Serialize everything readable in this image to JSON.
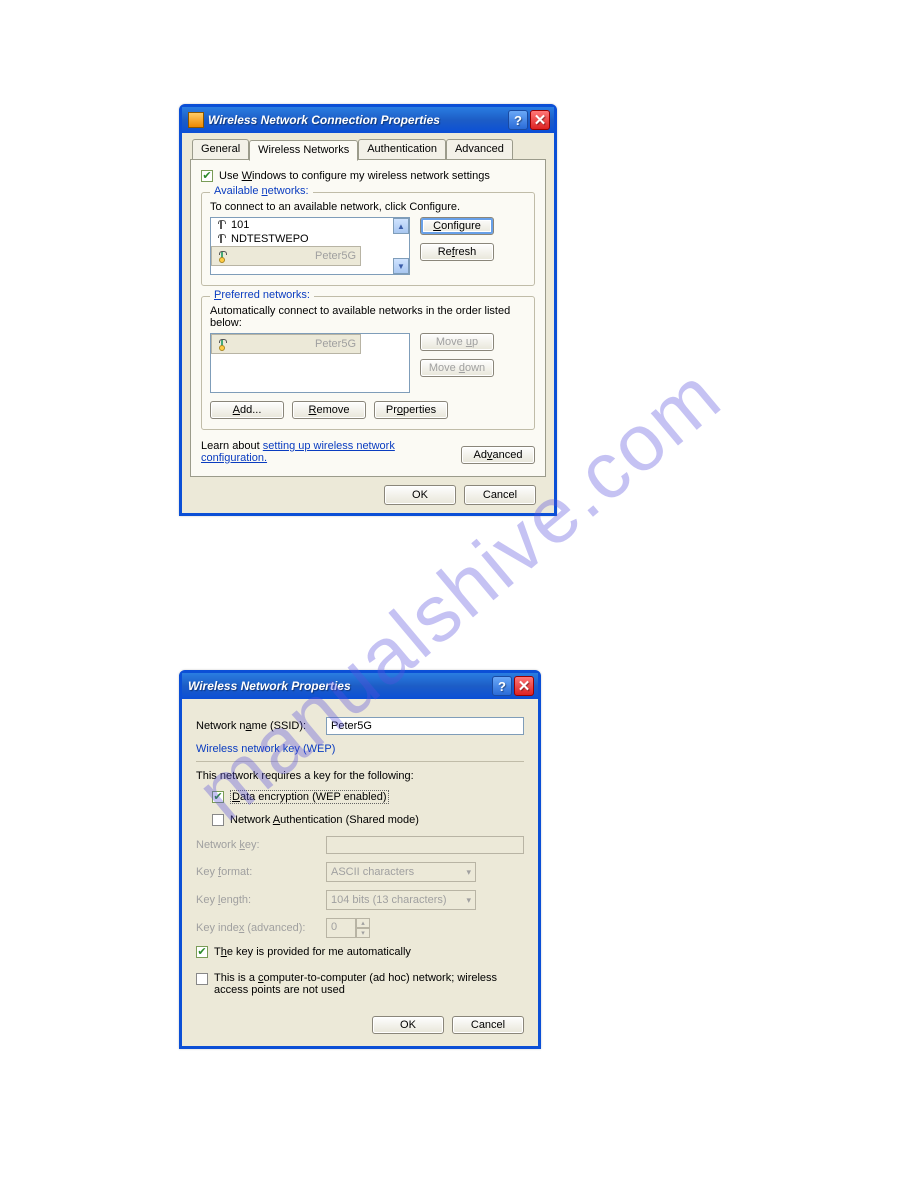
{
  "watermark": "manualshive.com",
  "dialog1": {
    "title": "Wireless Network Connection Properties",
    "tabs": [
      "General",
      "Wireless Networks",
      "Authentication",
      "Advanced"
    ],
    "active_tab": 1,
    "use_windows_label": "Use Windows to configure my wireless network settings",
    "use_windows_checked": true,
    "available": {
      "legend": "Available networks:",
      "instruction": "To connect to an available network, click Configure.",
      "items": [
        {
          "name": "101",
          "secure": false
        },
        {
          "name": "NDTESTWEPO",
          "secure": false
        },
        {
          "name": "Peter5G",
          "secure": true,
          "selected": true
        }
      ],
      "configure": "Configure",
      "refresh": "Refresh"
    },
    "preferred": {
      "legend": "Preferred networks:",
      "instruction": "Automatically connect to available networks in the order listed below:",
      "items": [
        {
          "name": "Peter5G",
          "secure": true,
          "selected": true
        }
      ],
      "moveup": "Move up",
      "movedown": "Move down",
      "add": "Add...",
      "remove": "Remove",
      "properties": "Properties"
    },
    "learn_prefix": "Learn about ",
    "learn_link": "setting up wireless network configuration.",
    "advanced": "Advanced",
    "ok": "OK",
    "cancel": "Cancel"
  },
  "dialog2": {
    "title": "Wireless Network Properties",
    "ssid_label": "Network name (SSID):",
    "ssid_value": "Peter5G",
    "wep_legend": "Wireless network key (WEP)",
    "wep_desc": "This network requires a key for the following:",
    "data_enc_label": "Data encryption (WEP enabled)",
    "data_enc_checked": true,
    "net_auth_label": "Network Authentication (Shared mode)",
    "net_auth_checked": false,
    "network_key_label": "Network key:",
    "key_format_label": "Key format:",
    "key_format_value": "ASCII characters",
    "key_length_label": "Key length:",
    "key_length_value": "104 bits (13 characters)",
    "key_index_label": "Key index (advanced):",
    "key_index_value": "0",
    "auto_key_label": "The key is provided for me automatically",
    "auto_key_checked": true,
    "adhoc_label": "This is a computer-to-computer (ad hoc) network; wireless access points are not used",
    "adhoc_checked": false,
    "ok": "OK",
    "cancel": "Cancel"
  }
}
